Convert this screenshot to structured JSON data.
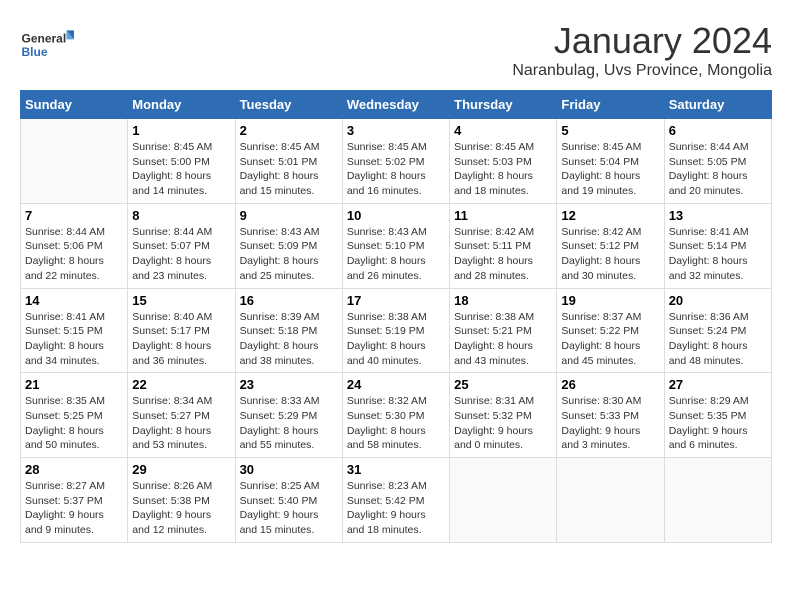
{
  "header": {
    "logo_general": "General",
    "logo_blue": "Blue",
    "title": "January 2024",
    "subtitle": "Naranbulag, Uvs Province, Mongolia"
  },
  "weekdays": [
    "Sunday",
    "Monday",
    "Tuesday",
    "Wednesday",
    "Thursday",
    "Friday",
    "Saturday"
  ],
  "weeks": [
    [
      {
        "day": "",
        "sunrise": "",
        "sunset": "",
        "daylight": ""
      },
      {
        "day": "1",
        "sunrise": "Sunrise: 8:45 AM",
        "sunset": "Sunset: 5:00 PM",
        "daylight": "Daylight: 8 hours and 14 minutes."
      },
      {
        "day": "2",
        "sunrise": "Sunrise: 8:45 AM",
        "sunset": "Sunset: 5:01 PM",
        "daylight": "Daylight: 8 hours and 15 minutes."
      },
      {
        "day": "3",
        "sunrise": "Sunrise: 8:45 AM",
        "sunset": "Sunset: 5:02 PM",
        "daylight": "Daylight: 8 hours and 16 minutes."
      },
      {
        "day": "4",
        "sunrise": "Sunrise: 8:45 AM",
        "sunset": "Sunset: 5:03 PM",
        "daylight": "Daylight: 8 hours and 18 minutes."
      },
      {
        "day": "5",
        "sunrise": "Sunrise: 8:45 AM",
        "sunset": "Sunset: 5:04 PM",
        "daylight": "Daylight: 8 hours and 19 minutes."
      },
      {
        "day": "6",
        "sunrise": "Sunrise: 8:44 AM",
        "sunset": "Sunset: 5:05 PM",
        "daylight": "Daylight: 8 hours and 20 minutes."
      }
    ],
    [
      {
        "day": "7",
        "sunrise": "Sunrise: 8:44 AM",
        "sunset": "Sunset: 5:06 PM",
        "daylight": "Daylight: 8 hours and 22 minutes."
      },
      {
        "day": "8",
        "sunrise": "Sunrise: 8:44 AM",
        "sunset": "Sunset: 5:07 PM",
        "daylight": "Daylight: 8 hours and 23 minutes."
      },
      {
        "day": "9",
        "sunrise": "Sunrise: 8:43 AM",
        "sunset": "Sunset: 5:09 PM",
        "daylight": "Daylight: 8 hours and 25 minutes."
      },
      {
        "day": "10",
        "sunrise": "Sunrise: 8:43 AM",
        "sunset": "Sunset: 5:10 PM",
        "daylight": "Daylight: 8 hours and 26 minutes."
      },
      {
        "day": "11",
        "sunrise": "Sunrise: 8:42 AM",
        "sunset": "Sunset: 5:11 PM",
        "daylight": "Daylight: 8 hours and 28 minutes."
      },
      {
        "day": "12",
        "sunrise": "Sunrise: 8:42 AM",
        "sunset": "Sunset: 5:12 PM",
        "daylight": "Daylight: 8 hours and 30 minutes."
      },
      {
        "day": "13",
        "sunrise": "Sunrise: 8:41 AM",
        "sunset": "Sunset: 5:14 PM",
        "daylight": "Daylight: 8 hours and 32 minutes."
      }
    ],
    [
      {
        "day": "14",
        "sunrise": "Sunrise: 8:41 AM",
        "sunset": "Sunset: 5:15 PM",
        "daylight": "Daylight: 8 hours and 34 minutes."
      },
      {
        "day": "15",
        "sunrise": "Sunrise: 8:40 AM",
        "sunset": "Sunset: 5:17 PM",
        "daylight": "Daylight: 8 hours and 36 minutes."
      },
      {
        "day": "16",
        "sunrise": "Sunrise: 8:39 AM",
        "sunset": "Sunset: 5:18 PM",
        "daylight": "Daylight: 8 hours and 38 minutes."
      },
      {
        "day": "17",
        "sunrise": "Sunrise: 8:38 AM",
        "sunset": "Sunset: 5:19 PM",
        "daylight": "Daylight: 8 hours and 40 minutes."
      },
      {
        "day": "18",
        "sunrise": "Sunrise: 8:38 AM",
        "sunset": "Sunset: 5:21 PM",
        "daylight": "Daylight: 8 hours and 43 minutes."
      },
      {
        "day": "19",
        "sunrise": "Sunrise: 8:37 AM",
        "sunset": "Sunset: 5:22 PM",
        "daylight": "Daylight: 8 hours and 45 minutes."
      },
      {
        "day": "20",
        "sunrise": "Sunrise: 8:36 AM",
        "sunset": "Sunset: 5:24 PM",
        "daylight": "Daylight: 8 hours and 48 minutes."
      }
    ],
    [
      {
        "day": "21",
        "sunrise": "Sunrise: 8:35 AM",
        "sunset": "Sunset: 5:25 PM",
        "daylight": "Daylight: 8 hours and 50 minutes."
      },
      {
        "day": "22",
        "sunrise": "Sunrise: 8:34 AM",
        "sunset": "Sunset: 5:27 PM",
        "daylight": "Daylight: 8 hours and 53 minutes."
      },
      {
        "day": "23",
        "sunrise": "Sunrise: 8:33 AM",
        "sunset": "Sunset: 5:29 PM",
        "daylight": "Daylight: 8 hours and 55 minutes."
      },
      {
        "day": "24",
        "sunrise": "Sunrise: 8:32 AM",
        "sunset": "Sunset: 5:30 PM",
        "daylight": "Daylight: 8 hours and 58 minutes."
      },
      {
        "day": "25",
        "sunrise": "Sunrise: 8:31 AM",
        "sunset": "Sunset: 5:32 PM",
        "daylight": "Daylight: 9 hours and 0 minutes."
      },
      {
        "day": "26",
        "sunrise": "Sunrise: 8:30 AM",
        "sunset": "Sunset: 5:33 PM",
        "daylight": "Daylight: 9 hours and 3 minutes."
      },
      {
        "day": "27",
        "sunrise": "Sunrise: 8:29 AM",
        "sunset": "Sunset: 5:35 PM",
        "daylight": "Daylight: 9 hours and 6 minutes."
      }
    ],
    [
      {
        "day": "28",
        "sunrise": "Sunrise: 8:27 AM",
        "sunset": "Sunset: 5:37 PM",
        "daylight": "Daylight: 9 hours and 9 minutes."
      },
      {
        "day": "29",
        "sunrise": "Sunrise: 8:26 AM",
        "sunset": "Sunset: 5:38 PM",
        "daylight": "Daylight: 9 hours and 12 minutes."
      },
      {
        "day": "30",
        "sunrise": "Sunrise: 8:25 AM",
        "sunset": "Sunset: 5:40 PM",
        "daylight": "Daylight: 9 hours and 15 minutes."
      },
      {
        "day": "31",
        "sunrise": "Sunrise: 8:23 AM",
        "sunset": "Sunset: 5:42 PM",
        "daylight": "Daylight: 9 hours and 18 minutes."
      },
      {
        "day": "",
        "sunrise": "",
        "sunset": "",
        "daylight": ""
      },
      {
        "day": "",
        "sunrise": "",
        "sunset": "",
        "daylight": ""
      },
      {
        "day": "",
        "sunrise": "",
        "sunset": "",
        "daylight": ""
      }
    ]
  ]
}
